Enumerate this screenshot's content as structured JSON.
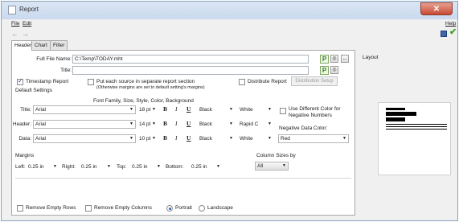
{
  "window": {
    "title": "Report",
    "close_label": "✕"
  },
  "menu": {
    "file": "File",
    "edit": "Edit",
    "help": "Help"
  },
  "nav": {
    "back": "←",
    "forward": "→"
  },
  "tabs": [
    "Header",
    "Chart",
    "Filter"
  ],
  "header_tab": {
    "full_file_name_label": "Full File Name:",
    "full_file_name_value": "C:\\Temp\\TODAY.mht",
    "title_label": "Title:",
    "title_value": "",
    "p_label": "P",
    "browse_label": "...",
    "timestamp_label": "Timestamp Report",
    "timestamp_checked": true,
    "separate_section_label": "Put each source in separate report section",
    "separate_section_note": "(Otherwise margins are set to default setting's margins)",
    "separate_section_checked": false,
    "distribute_label": "Distribute Report",
    "distribute_checked": false,
    "distribution_setup_label": "Distribution Setup",
    "default_settings_label": "Default Settings",
    "font_heading": "Font Family, Size, Style, Color, Background",
    "bold_label": "B",
    "italic_label": "I",
    "underline_label": "U",
    "rows": [
      {
        "label": "Title:",
        "font": "Arial",
        "size": "18 pt",
        "color": "Black",
        "background": "White"
      },
      {
        "label": "Header:",
        "font": "Arial",
        "size": "14 pt",
        "color": "Black",
        "background": "Rapid C"
      },
      {
        "label": "Data:",
        "font": "Arial",
        "size": "10 pt",
        "color": "Black",
        "background": "White"
      }
    ],
    "diff_color_label_1": "Use Different Color for",
    "diff_color_label_2": "Negative Numbers",
    "diff_color_checked": false,
    "negative_color_label": "Negative Data Color:",
    "negative_color_value": "Red",
    "margins_label": "Margins",
    "left_label": "Left:",
    "left_value": "0.25 in",
    "right_label": "Right:",
    "right_value": "0.25 in",
    "top_label": "Top:",
    "top_value": "0.25 in",
    "bottom_label": "Bottom:",
    "bottom_value": "0.25 in",
    "column_sizes_label": "Column Sizes by",
    "column_sizes_value": "All",
    "remove_rows_label": "Remove Empty Rows",
    "remove_rows_checked": false,
    "remove_cols_label": "Remove Empty Columns",
    "remove_cols_checked": false,
    "portrait_label": "Portrait",
    "landscape_label": "Landscape",
    "orientation": "Portrait"
  },
  "layout": {
    "label": "Layout"
  },
  "colors": {
    "titlebar": "#c9d9ee",
    "close": "#c74a32",
    "accent_check": "#3f9f2a"
  }
}
